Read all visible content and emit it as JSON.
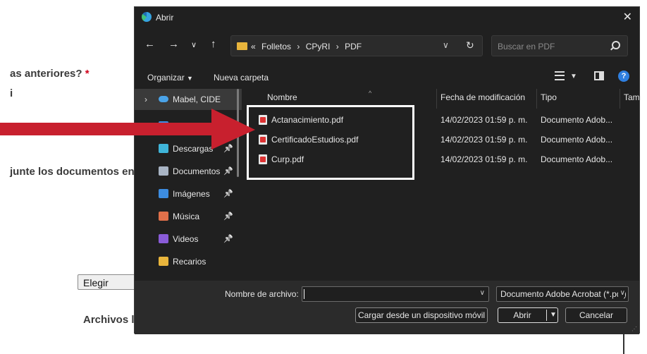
{
  "background": {
    "question_tail": "as anteriores?",
    "required_mark": "*",
    "option_fragment": "i",
    "instruction_fragment": "junte los documentos en",
    "choose_button": "Elegir archivo",
    "files_label": "Archivos l"
  },
  "dialog": {
    "title": "Abrir",
    "address": {
      "overflow": "«",
      "crumbs": [
        "Folletos",
        "›",
        "CPyRI",
        "›",
        "PDF"
      ]
    },
    "search_placeholder": "Buscar en PDF",
    "toolbar": {
      "organize": "Organizar",
      "new_folder": "Nueva carpeta"
    },
    "nav": {
      "selected": "Mabel, CIDE",
      "items": [
        {
          "label": "Escritorio",
          "icon": "desktop-icon",
          "color": "#3a8ee6"
        },
        {
          "label": "Descargas",
          "icon": "download-icon",
          "color": "#3fb5d9"
        },
        {
          "label": "Documentos",
          "icon": "documents-icon",
          "color": "#a8b4c4"
        },
        {
          "label": "Imágenes",
          "icon": "pictures-icon",
          "color": "#3c8ce0"
        },
        {
          "label": "Música",
          "icon": "music-icon",
          "color": "#e0704a"
        },
        {
          "label": "Videos",
          "icon": "videos-icon",
          "color": "#8a5cd8"
        },
        {
          "label": "Recarios",
          "icon": "folder-icon",
          "color": "#e9b53c"
        }
      ]
    },
    "columns": {
      "name": "Nombre",
      "modified": "Fecha de modificación",
      "type": "Tipo",
      "size": "Tam"
    },
    "files": [
      {
        "name": "Actanacimiento.pdf",
        "modified": "14/02/2023 01:59 p. m.",
        "type": "Documento Adob..."
      },
      {
        "name": "CertificadoEstudios.pdf",
        "modified": "14/02/2023 01:59 p. m.",
        "type": "Documento Adob..."
      },
      {
        "name": "Curp.pdf",
        "modified": "14/02/2023 01:59 p. m.",
        "type": "Documento Adob..."
      }
    ],
    "footer": {
      "filename_label": "Nombre de archivo:",
      "filename_value": "",
      "file_type": "Documento Adobe Acrobat (*.pdf)",
      "mobile_button": "Cargar desde un dispositivo móvil",
      "open_button": "Abrir",
      "cancel_button": "Cancelar"
    }
  },
  "colors": {
    "dialog_bg": "#202020",
    "arrow": "#c8202e",
    "highlight_box": "#ffffff",
    "required": "#d0021b"
  }
}
